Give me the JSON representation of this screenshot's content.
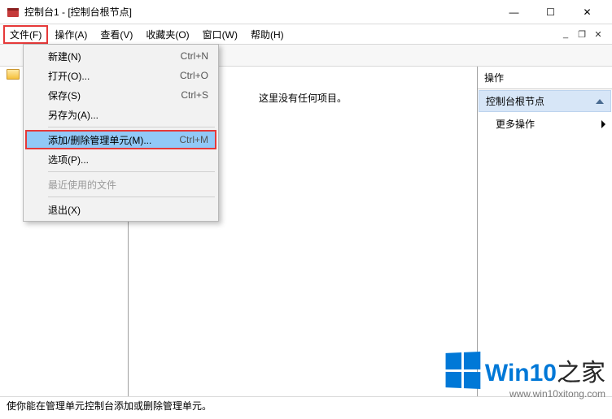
{
  "title": "控制台1 - [控制台根节点]",
  "window_buttons": {
    "min": "—",
    "max": "☐",
    "close": "✕"
  },
  "menus": {
    "file": "文件(F)",
    "action": "操作(A)",
    "view": "查看(V)",
    "fav": "收藏夹(O)",
    "window": "窗口(W)",
    "help": "帮助(H)"
  },
  "file_menu": {
    "new": {
      "label": "新建(N)",
      "accel": "Ctrl+N"
    },
    "open": {
      "label": "打开(O)...",
      "accel": "Ctrl+O"
    },
    "save": {
      "label": "保存(S)",
      "accel": "Ctrl+S"
    },
    "saveas": {
      "label": "另存为(A)...",
      "accel": ""
    },
    "snapin": {
      "label": "添加/删除管理单元(M)...",
      "accel": "Ctrl+M"
    },
    "options": {
      "label": "选项(P)...",
      "accel": ""
    },
    "recent": {
      "label": "最近使用的文件",
      "accel": ""
    },
    "exit": {
      "label": "退出(X)",
      "accel": ""
    }
  },
  "list_empty": "这里没有任何项目。",
  "actions": {
    "header": "操作",
    "root": "控制台根节点",
    "more": "更多操作"
  },
  "status": "使你能在管理单元控制台添加或删除管理单元。",
  "watermark": {
    "brand_a": "Win10",
    "brand_b": "之家",
    "url": "www.win10xitong.com"
  }
}
